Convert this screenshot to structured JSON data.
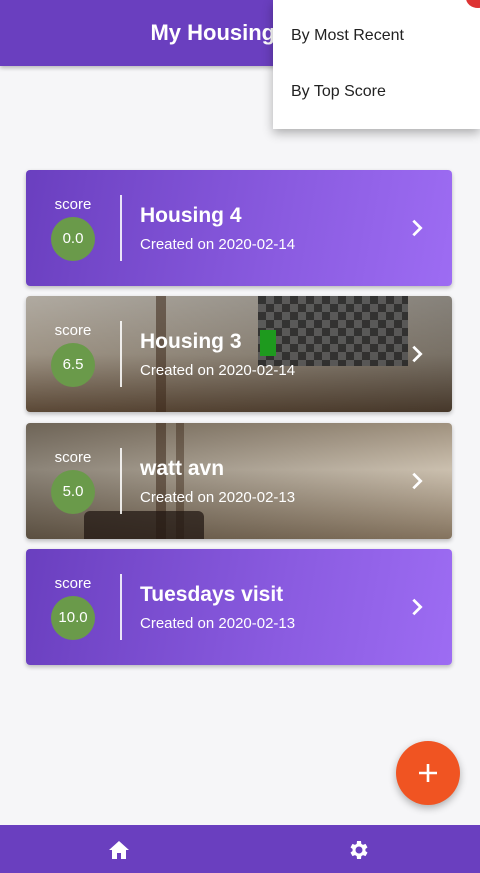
{
  "appbar": {
    "title": "My Housing Visits"
  },
  "sort_menu": {
    "items": [
      {
        "label": "By Most Recent"
      },
      {
        "label": "By Top Score"
      }
    ]
  },
  "cards": [
    {
      "score_label": "score",
      "score": "0.0",
      "title": "Housing 4",
      "subtitle": "Created on 2020-02-14",
      "background": "purple"
    },
    {
      "score_label": "score",
      "score": "6.5",
      "title": "Housing 3",
      "subtitle": "Created on 2020-02-14",
      "background": "photo"
    },
    {
      "score_label": "score",
      "score": "5.0",
      "title": "watt avn",
      "subtitle": "Created on 2020-02-13",
      "background": "photo"
    },
    {
      "score_label": "score",
      "score": "10.0",
      "title": "Tuesdays visit",
      "subtitle": "Created on 2020-02-13",
      "background": "purple"
    }
  ],
  "fab": {
    "icon": "plus-icon"
  },
  "bottom_nav": {
    "items": [
      {
        "icon": "home-icon"
      },
      {
        "icon": "gear-icon"
      }
    ]
  },
  "colors": {
    "primary": "#6a3fbf",
    "accent": "#f05422",
    "score_badge": "#6a9a4a"
  }
}
